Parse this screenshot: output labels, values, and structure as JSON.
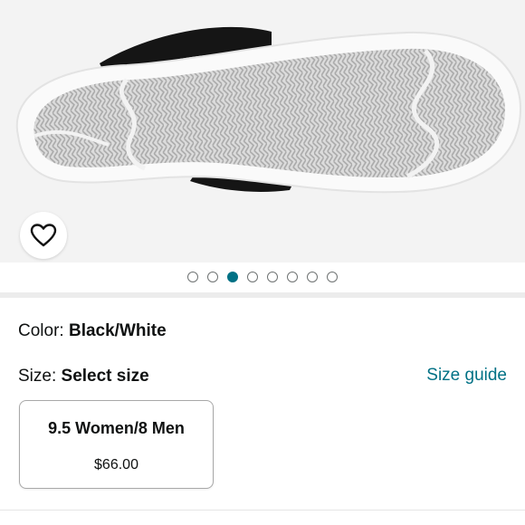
{
  "gallery": {
    "image_icon": "shoe-sole-image",
    "favorite_icon": "heart-outline-icon",
    "dots_count": 8,
    "active_dot": 3
  },
  "colors": {
    "accent": "#007185",
    "text": "#0f1111",
    "hero_bg": "#f3f3f3"
  },
  "product": {
    "color_label": "Color:",
    "color_value": "Black/White",
    "size_label": "Size:",
    "size_value": "Select size",
    "size_guide": "Size guide"
  },
  "size_options": [
    {
      "name": "9.5 Women/8 Men",
      "price": "$66.00"
    }
  ]
}
